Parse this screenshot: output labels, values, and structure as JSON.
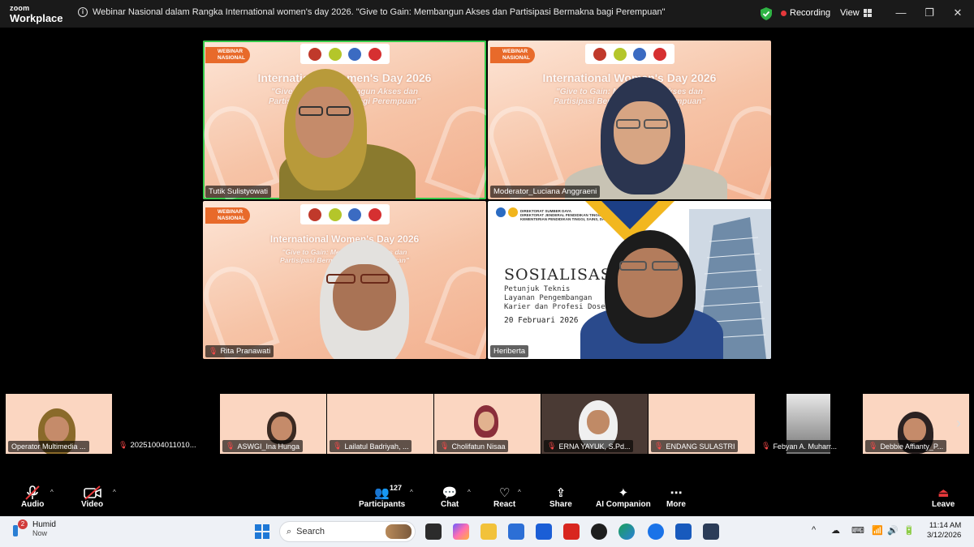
{
  "app": {
    "logo_line1": "zoom",
    "logo_line2": "Workplace"
  },
  "meeting": {
    "title": "Webinar Nasional dalam Rangka International women's day 2026. \"Give to Gain: Membangun Akses dan Partisipasi Bermakna bagi Perempuan\"",
    "recording_label": "Recording",
    "view_label": "View"
  },
  "window_controls": {
    "minimize": "—",
    "restore": "❐",
    "close": "✕"
  },
  "slide": {
    "badge_line1": "WEBINAR",
    "badge_line2": "NASIONAL",
    "title": "International Women's Day 2026",
    "subtitle_line1": "\"Give to Gain: Membangun Akses dan",
    "subtitle_line2": "Partisipasi Bermakna bagi Perempuan\""
  },
  "tiles": [
    {
      "name": "Tutik Sulistyowati",
      "muted": false,
      "active": true
    },
    {
      "name": "Moderator_Luciana Anggraeni",
      "muted": false,
      "active": false
    },
    {
      "name": "Rita Pranawati",
      "muted": true,
      "active": false
    },
    {
      "name": "Heriberta",
      "muted": false,
      "active": false
    }
  ],
  "presentation": {
    "header": "DIREKTORAT SUMBER DAYA\nDIREKTORAT JENDERAL PENDIDIKAN TINGGI\nKEMENTERIAN PENDIDIKAN TINGGI, SAINS, DAN TEKNOLOGI",
    "title": "SOSIALISASI",
    "line1": "Petunjuk Teknis",
    "line2": "Layanan Pengembangan",
    "line3": "Karier dan Profesi Dosen",
    "date": "20 Februari 2026"
  },
  "thumbnails": [
    {
      "name": "Operator Multimedia ...",
      "muted": false
    },
    {
      "name": "20251004011010...",
      "muted": true
    },
    {
      "name": "ASWGI_Ina Hunga",
      "muted": true
    },
    {
      "name": "Lailatul Badriyah, ...",
      "muted": true
    },
    {
      "name": "Cholifatun Nisaa",
      "muted": true
    },
    {
      "name": "ERNA YAYUK, S.Pd...",
      "muted": true
    },
    {
      "name": "ENDANG SULASTRI",
      "muted": true
    },
    {
      "name": "Febyan A. Muharr...",
      "muted": true
    },
    {
      "name": "Debbie Affianty_P...",
      "muted": true
    }
  ],
  "toolbar": {
    "audio": "Audio",
    "video": "Video",
    "participants": "Participants",
    "participants_count": "127",
    "chat": "Chat",
    "react": "React",
    "share": "Share",
    "ai_companion": "AI Companion",
    "more": "More",
    "leave": "Leave"
  },
  "taskbar": {
    "weather_title": "Humid",
    "weather_sub": "Now",
    "weather_badge": "2",
    "search_placeholder": "Search",
    "time": "11:14 AM",
    "date": "3/12/2026"
  },
  "colors": {
    "active_speaker": "#35c94a",
    "recording_dot": "#e5383b",
    "slide_accent": "#e86a2a",
    "muted_icon": "#ff4a4a"
  }
}
